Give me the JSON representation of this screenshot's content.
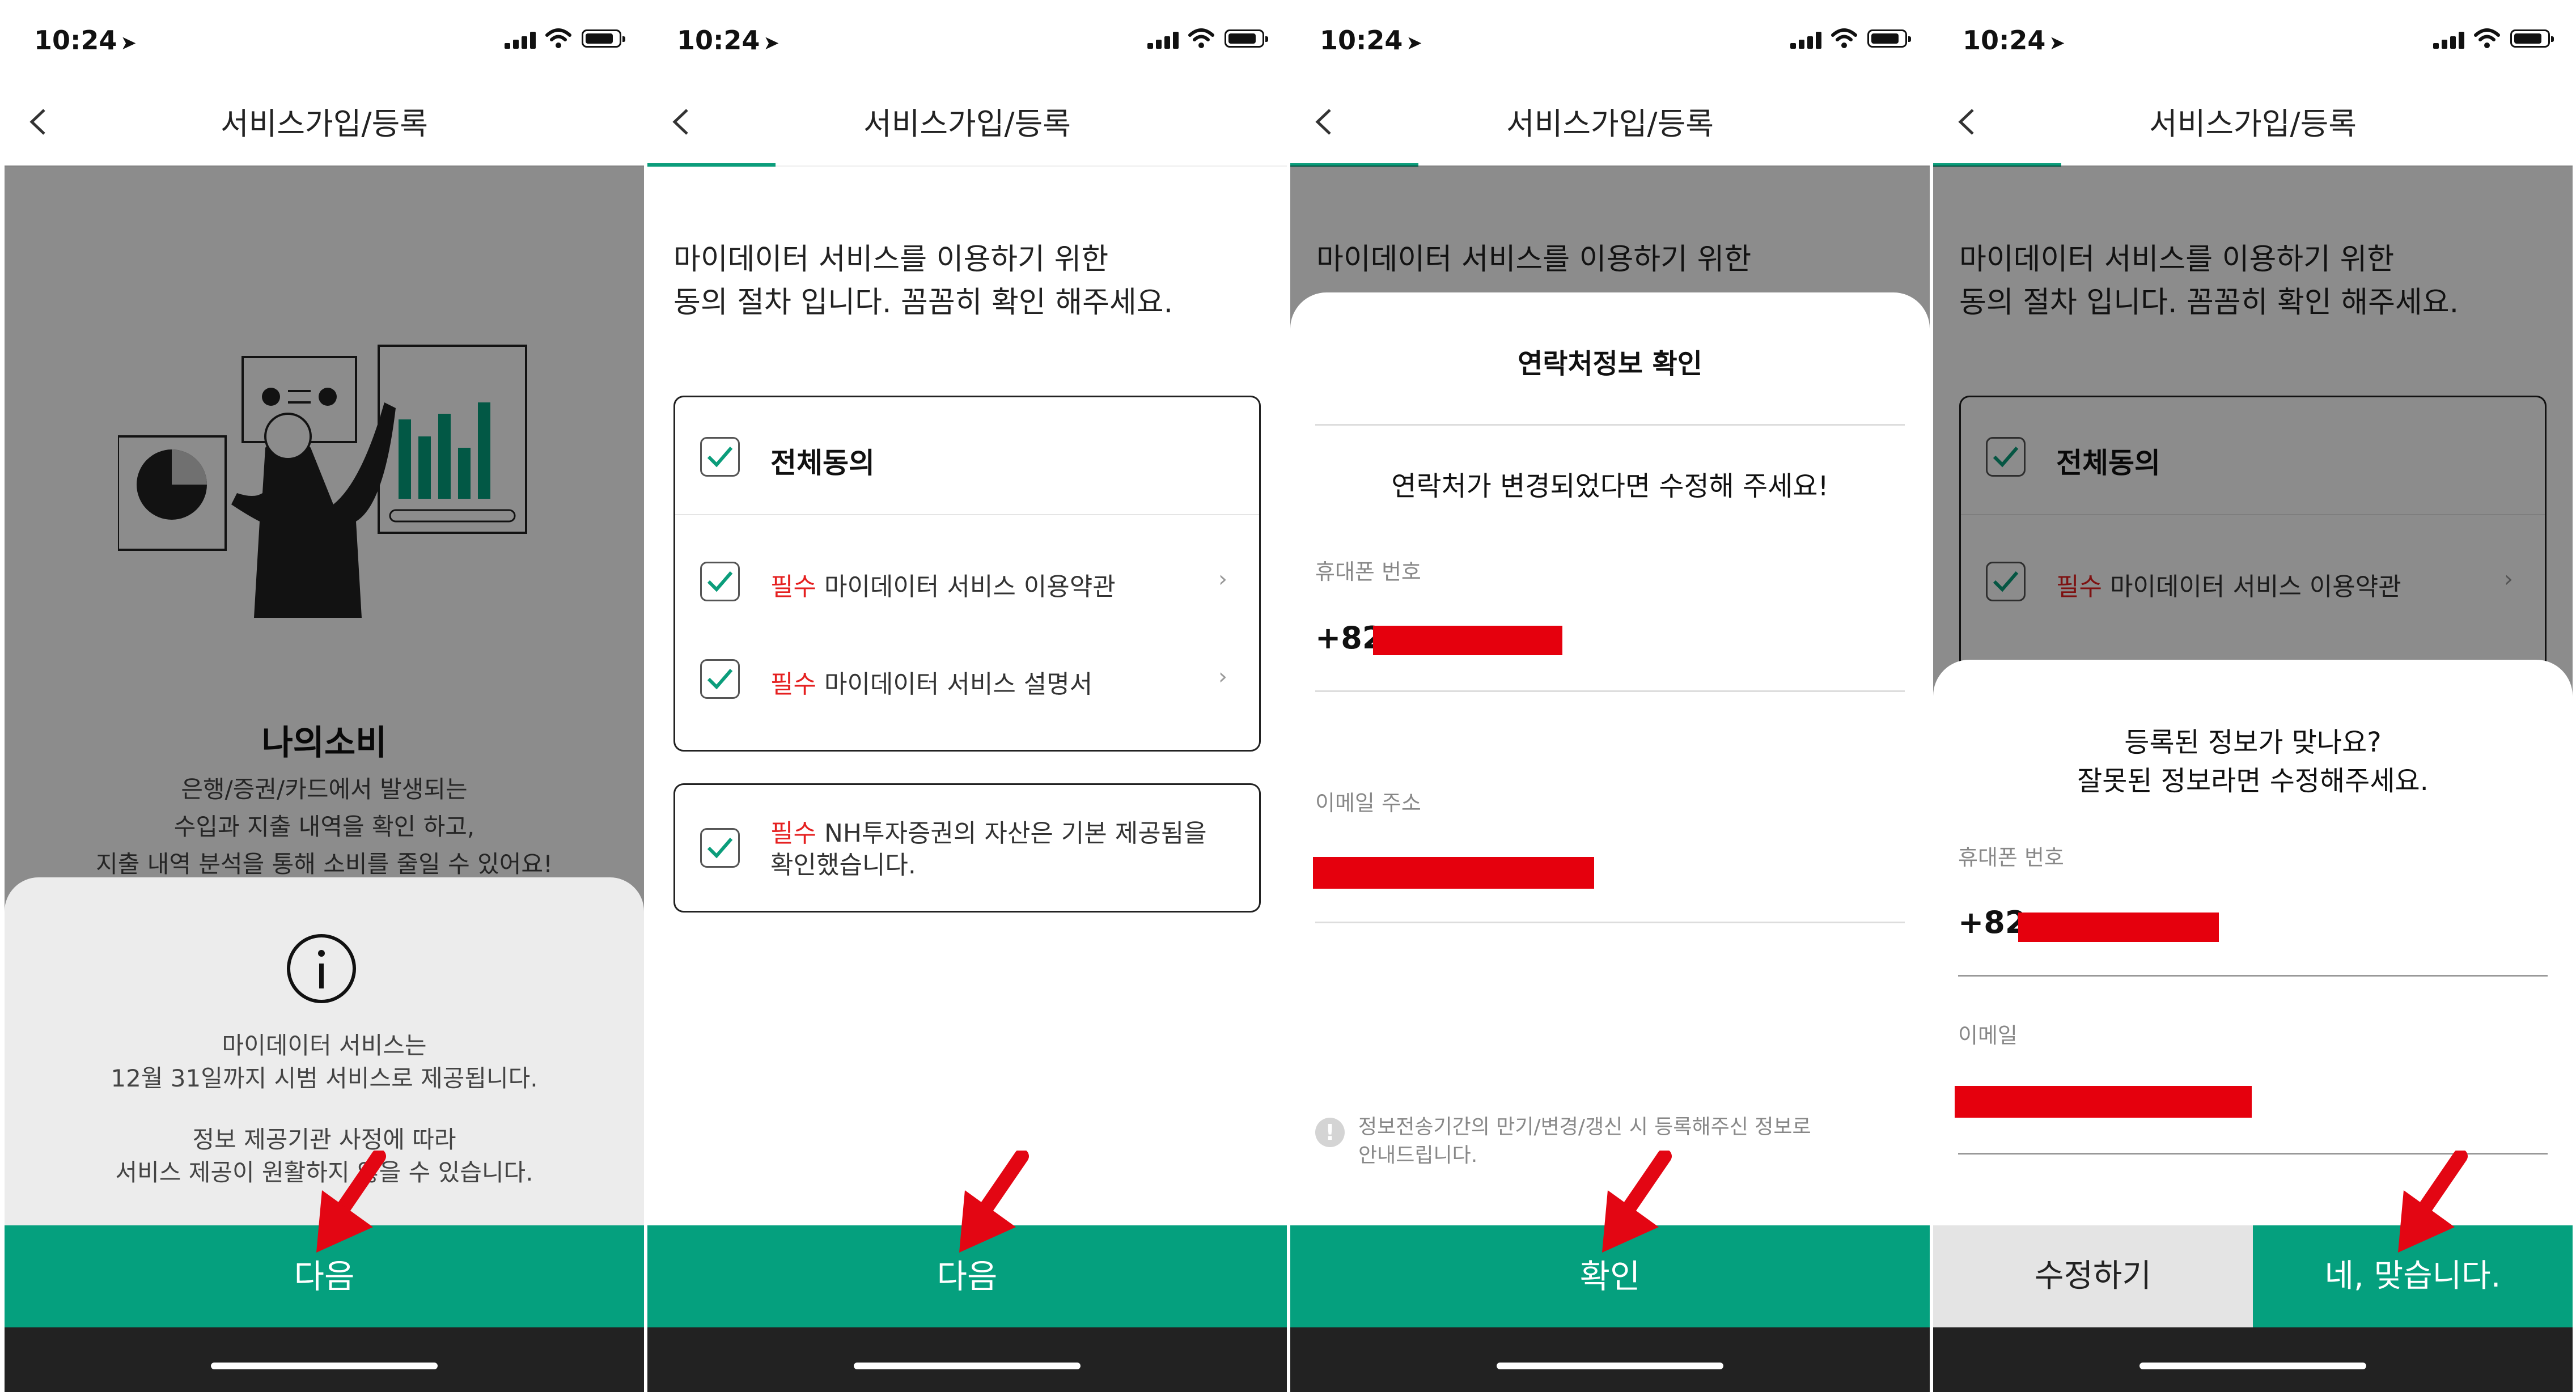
{
  "status_bar": {
    "time": "10:24"
  },
  "header": {
    "title": "서비스가입/등록"
  },
  "screen1": {
    "feature_title": "나의소비",
    "feature_desc": [
      "은행/증권/카드에서 발생되는",
      "수입과 지출 내역을 확인 하고,",
      "지출 내역 분석을 통해 소비를 줄일 수 있어요!"
    ],
    "notice_line1": "마이데이터 서비스는",
    "notice_line2": "12월 31일까지 시범 서비스로 제공됩니다.",
    "notice_line3": "정보 제공기관 사정에 따라",
    "notice_line4": "서비스 제공이 원활하지 않을 수 있습니다.",
    "next_button": "다음"
  },
  "consent": {
    "intro_line1": "마이데이터 서비스를 이용하기 위한",
    "intro_line2": "동의 절차 입니다. 꼼꼼히 확인 해주세요.",
    "agree_all": "전체동의",
    "required_tag": "필수",
    "item1": "마이데이터 서비스 이용약관",
    "item2": "마이데이터 서비스 설명서",
    "item3_line1": "NH투자증권의 자산은 기본 제공됨을",
    "item3_line2": "확인했습니다.",
    "next_button": "다음"
  },
  "contact_confirm": {
    "title": "연락처정보 확인",
    "message": "연락처가 변경되었다면 수정해 주세요!",
    "phone_label": "휴대폰 번호",
    "phone_prefix": "+82",
    "email_label": "이메일 주소",
    "note_line1": "정보전송기간의 만기/변경/갱신 시 등록해주신 정보로",
    "note_line2": "안내드립니다.",
    "confirm_button": "확인"
  },
  "verify": {
    "question_line1": "등록된 정보가 맞나요?",
    "question_line2": "잘못된 정보라면 수정해주세요.",
    "phone_label": "휴대폰 번호",
    "phone_prefix": "+82",
    "email_label": "이메일",
    "edit_button": "수정하기",
    "yes_button": "네, 맞습니다."
  },
  "colors": {
    "accent": "#05a07e",
    "required": "#e52020",
    "arrow": "#e30613",
    "redaction": "#e5000d"
  }
}
